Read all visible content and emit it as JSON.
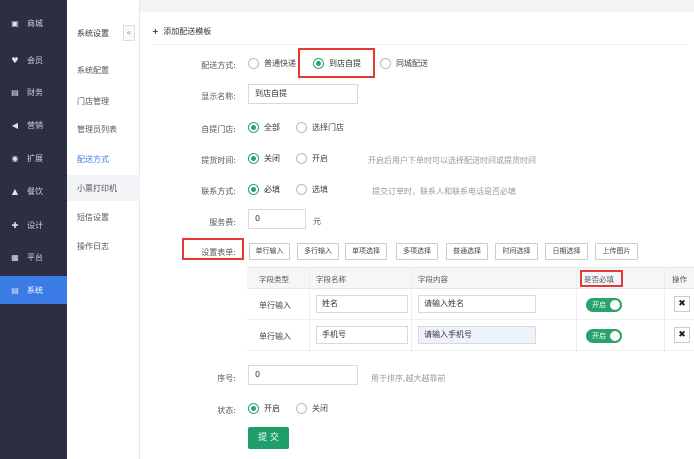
{
  "nav": {
    "items": [
      {
        "icon": "▣",
        "label": "商城"
      },
      {
        "icon": "♥",
        "label": "会员"
      },
      {
        "icon": "▤",
        "label": "财务"
      },
      {
        "icon": "◀",
        "label": "营销"
      },
      {
        "icon": "◉",
        "label": "扩展"
      },
      {
        "icon": "▲",
        "label": "餐饮"
      },
      {
        "icon": "✚",
        "label": "设计"
      },
      {
        "icon": "▦",
        "label": "平台"
      },
      {
        "icon": "▤",
        "label": "系统"
      }
    ]
  },
  "subnav": {
    "title": "系统设置",
    "collapse": "«",
    "items": [
      {
        "label": "系统配置"
      },
      {
        "label": "门店管理"
      },
      {
        "label": "管理员列表"
      },
      {
        "label": "配送方式"
      },
      {
        "label": "小票打印机"
      },
      {
        "label": "短信设置"
      },
      {
        "label": "操作日志"
      }
    ]
  },
  "page": {
    "title_plus": "+",
    "title": "添加配送模板"
  },
  "form": {
    "delivery": {
      "label": "配送方式:",
      "opt1": "普通快递",
      "opt2": "到店自提",
      "opt3": "同城配送"
    },
    "display_name": {
      "label": "显示名称:",
      "value": "到店自提"
    },
    "store": {
      "label": "自提门店:",
      "opt1": "全部",
      "opt2": "选择门店"
    },
    "pickup_time": {
      "label": "提货时间:",
      "opt1": "关闭",
      "opt2": "开启",
      "hint": "开启后用户下单时可以选择配送时间或提货时间"
    },
    "contact": {
      "label": "联系方式:",
      "opt1": "必填",
      "opt2": "选填",
      "hint": "提交订单时，联系人和联系电话是否必填"
    },
    "fee": {
      "label": "服务费:",
      "value": "0",
      "unit": "元"
    },
    "form_setting": {
      "label": "设置表单:",
      "buttons": [
        "单行输入",
        "多行输入",
        "单项选择",
        "多项选择",
        "普通选择",
        "时间选择",
        "日期选择",
        "上传图片"
      ]
    },
    "table": {
      "headers": [
        "字段类型",
        "字段名称",
        "字段内容",
        "是否必填",
        "操作"
      ],
      "rows": [
        {
          "type": "单行输入",
          "name": "姓名",
          "content": "请输入姓名",
          "required": "开启",
          "delete": "✖"
        },
        {
          "type": "单行输入",
          "name": "手机号",
          "content": "请输入手机号",
          "required": "开启",
          "delete": "✖"
        }
      ]
    },
    "sort": {
      "label": "序号:",
      "value": "0",
      "hint": "用于排序,越大越靠前"
    },
    "status": {
      "label": "状态:",
      "opt1": "开启",
      "opt2": "关闭"
    },
    "submit": "提 交"
  },
  "colors": {
    "accent": "#3a7be5",
    "green": "#2aa36b",
    "highlight": "#e53935",
    "nav_bg": "#2c2e43"
  }
}
